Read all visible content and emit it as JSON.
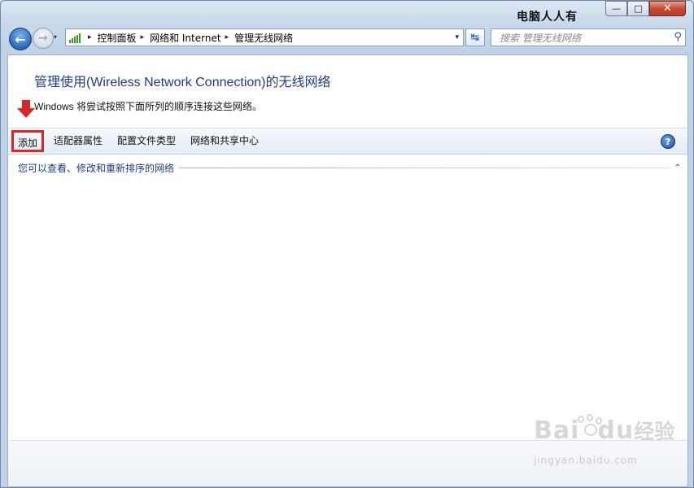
{
  "window": {
    "watermark_title": "电脑人人有"
  },
  "caption": {
    "minimize": "—",
    "maximize": "□",
    "close": "✕"
  },
  "nav": {
    "back_icon": "arrow-left",
    "forward_icon": "arrow-right",
    "dropdown": "▾"
  },
  "address": {
    "crumbs": [
      "控制面板",
      "网络和 Internet",
      "管理无线网络"
    ],
    "separator": "▸",
    "dropdown": "▾"
  },
  "refresh": {
    "symbol": "↹"
  },
  "search": {
    "placeholder": "搜索 管理无线网络"
  },
  "content": {
    "heading": "管理使用(Wireless Network Connection)的无线网络",
    "description": "Windows 将尝试按照下面所列的顺序连接这些网络。"
  },
  "toolbar": {
    "items": [
      "添加",
      "适配器属性",
      "配置文件类型",
      "网络和共享中心"
    ],
    "help": "?"
  },
  "group": {
    "label": "您可以查看、修改和重新排序的网络",
    "chevron": "⌃"
  },
  "watermark": {
    "brand": "Bai",
    "brand2": "du",
    "brand_cn": "经验",
    "url": "jingyan.baidu.com"
  },
  "colors": {
    "highlight": "#d8262d",
    "link_blue": "#1e3b87"
  }
}
